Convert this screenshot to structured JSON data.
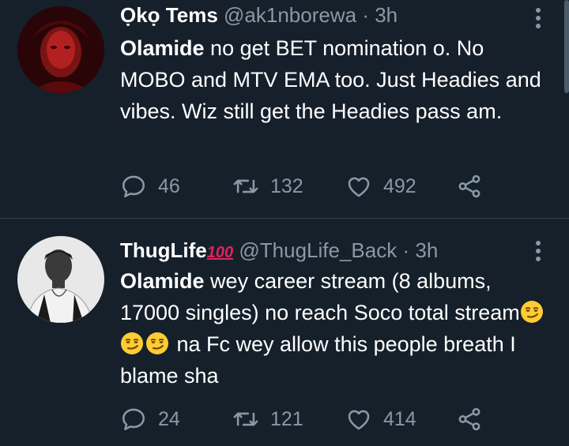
{
  "colors": {
    "background": "#15202b",
    "text": "#ffffff",
    "muted": "#8899a6",
    "divider": "#38444d"
  },
  "tweets": [
    {
      "name": "Ọkọ Tems",
      "badge": "",
      "handle": "@ak1nborewa",
      "separator": "·",
      "time": "3h",
      "mention": "Olamide",
      "text": " no get BET nomination o. No MOBO and MTV EMA too. Just Headies and vibes. Wiz still get the Headies pass am.",
      "text_after_emoji": "",
      "emojis": [],
      "replies": "46",
      "retweets": "132",
      "likes": "492",
      "icons": [
        "reply-icon",
        "retweet-icon",
        "like-icon",
        "share-icon",
        "more-icon"
      ]
    },
    {
      "name": "ThugLife",
      "badge": "100",
      "handle": "@ThugLife_Back",
      "separator": "·",
      "time": "3h",
      "mention": "Olamide",
      "text": " wey career stream (8 albums, 17000 singles) no reach Soco total stream",
      "text_after_emoji": " na Fc wey allow this people breath I blame sha",
      "emojis": [
        "smirking-face-emoji",
        "smirking-face-emoji",
        "smirking-face-emoji"
      ],
      "replies": "24",
      "retweets": "121",
      "likes": "414",
      "icons": [
        "reply-icon",
        "retweet-icon",
        "like-icon",
        "share-icon",
        "more-icon"
      ]
    }
  ]
}
